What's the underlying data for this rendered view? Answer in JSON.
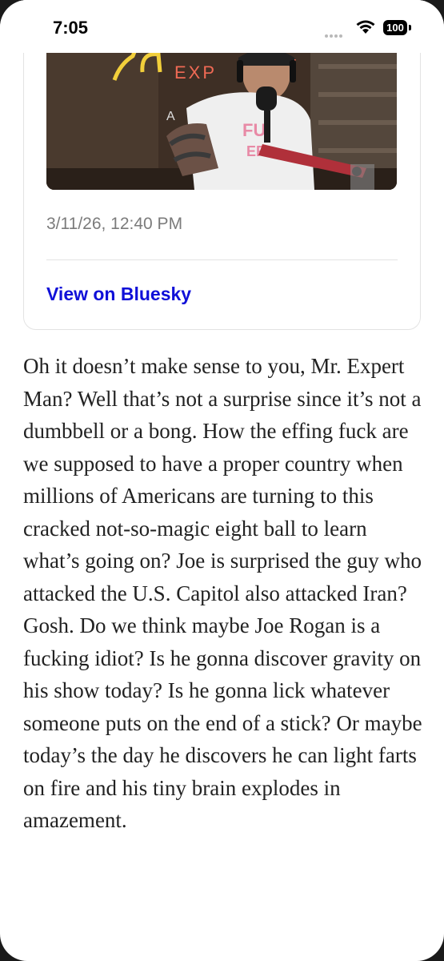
{
  "status_bar": {
    "time": "7:05",
    "battery": "100",
    "signal_icon": "cellular-dots-icon",
    "wifi_icon": "wifi-icon"
  },
  "embed": {
    "thumbnail": "podcast-video-still",
    "thumbnail_sign_text": "Joe Rogan Experience",
    "date": "3/11/26, 12:40 PM",
    "link_label": "View on Bluesky",
    "link_color": "#1010d8"
  },
  "article": {
    "paragraph": "Oh it doesn’t make sense to you, Mr. Expert Man? Well that’s not a surprise since it’s not a dumbbell or a bong. How the effing fuck are we supposed to have a proper country when millions of Americans are turning to this cracked not-so-magic eight ball to learn what’s going on? Joe is surprised the guy who attacked the U.S. Capitol also attacked Iran? Gosh. Do we think maybe Joe Rogan is a fucking idiot? Is he gonna discover gravity on his show today? Is he gonna lick whatever someone puts on the end of a stick? Or maybe today’s the day he discovers he can light farts on fire and his tiny brain explodes in amazement."
  }
}
